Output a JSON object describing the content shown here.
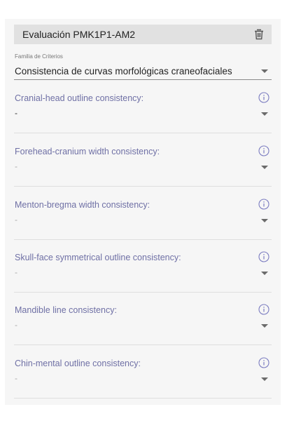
{
  "evaluation": {
    "title": "Evaluación PMK1P1-AM2",
    "delete_icon": "trash-icon"
  },
  "family": {
    "label": "Familia de Criterios",
    "value": "Consistencia de curvas morfológicas craneofaciales",
    "dropdown_icon": "caret-down-icon"
  },
  "criteria": [
    {
      "label": "Cranial-head outline consistency:",
      "value": "-"
    },
    {
      "label": "Forehead-cranium width consistency:",
      "value": "-"
    },
    {
      "label": "Menton-bregma width consistency:",
      "value": "-"
    },
    {
      "label": "Skull-face symmetrical outline consistency:",
      "value": "-"
    },
    {
      "label": "Mandible line consistency:",
      "value": "-"
    },
    {
      "label": "Chin-mental outline consistency:",
      "value": "-"
    }
  ],
  "colors": {
    "label_accent": "#6f70a5",
    "info_icon": "#7b7cc0",
    "header_bg": "#e1e1e1",
    "panel_bg": "#f6f6f6"
  }
}
